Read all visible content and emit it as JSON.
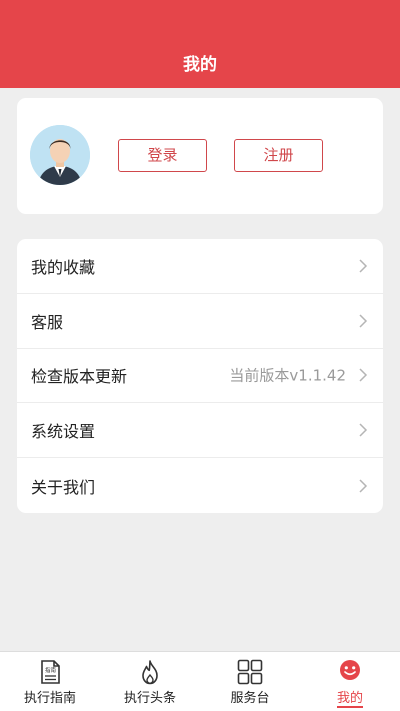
{
  "header": {
    "title": "我的"
  },
  "profile": {
    "login_label": "登录",
    "register_label": "注册"
  },
  "menu": {
    "items": [
      {
        "label": "我的收藏",
        "value": ""
      },
      {
        "label": "客服",
        "value": ""
      },
      {
        "label": "检查版本更新",
        "value": "当前版本v1.1.42"
      },
      {
        "label": "系统设置",
        "value": ""
      },
      {
        "label": "关于我们",
        "value": ""
      }
    ]
  },
  "tabbar": {
    "tabs": [
      {
        "label": "执行指南",
        "icon": "guide-doc-icon",
        "icon_text": "指南",
        "active": false
      },
      {
        "label": "执行头条",
        "icon": "flame-icon",
        "active": false
      },
      {
        "label": "服务台",
        "icon": "grid-icon",
        "active": false
      },
      {
        "label": "我的",
        "icon": "smiley-icon",
        "active": true
      }
    ]
  },
  "colors": {
    "accent": "#e5454a",
    "button_border": "#d0474b",
    "background": "#eeeeee"
  }
}
